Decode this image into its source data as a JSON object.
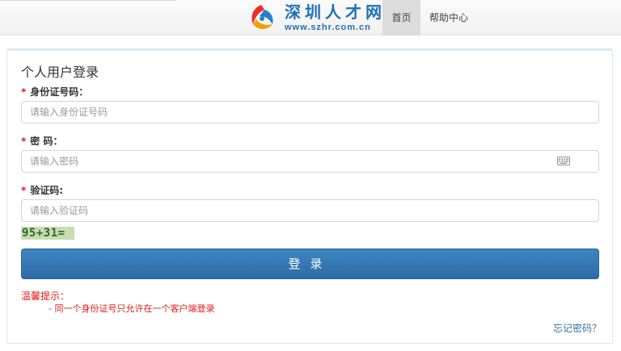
{
  "header": {
    "brand_name": "深圳人才网",
    "brand_url": "www.szhr.com.cn",
    "nav": [
      {
        "label": "首页",
        "active": true
      },
      {
        "label": "帮助中心",
        "active": false
      }
    ]
  },
  "form": {
    "title": "个人用户登录",
    "required_mark": "*",
    "id_label": "身份证号码：",
    "id_placeholder": "请输入身份证号码",
    "password_label": "密 码：",
    "password_placeholder": "请输入密码",
    "captcha_label": "验证码:",
    "captcha_placeholder": "请输入验证码",
    "captcha_text": "95+31=",
    "login_label": "登录"
  },
  "tips": {
    "title": "温馨提示：",
    "item": "- 同一个身份证号只允许在一个客户端登录"
  },
  "forgot_password": "忘记密码？",
  "colors": {
    "brand": "#1f6fb8",
    "button": "#2d6aa4",
    "warning": "#e0191b",
    "link": "#3a6fa2"
  },
  "icons": {
    "keyboard": "keyboard-icon",
    "logo": "szhr-logo-icon"
  }
}
